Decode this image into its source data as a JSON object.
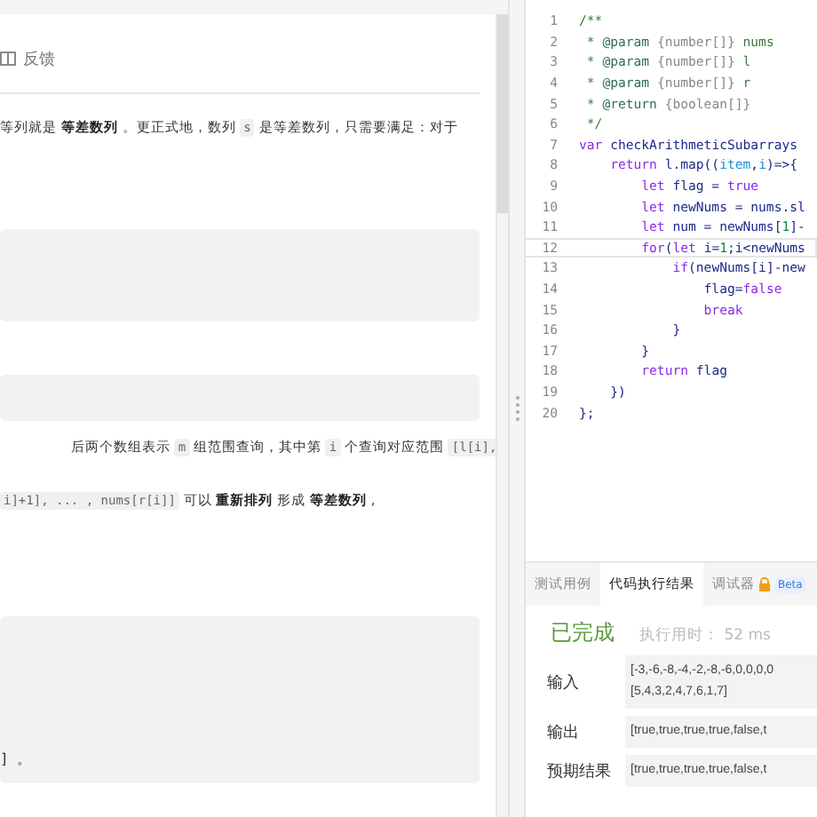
{
  "toolbar": {
    "feedback": "反馈"
  },
  "description": {
    "paras": [
      [
        {
          "text": "等列就是 ",
          "kind": "text"
        },
        {
          "text": "等差数列",
          "kind": "bold"
        },
        {
          "text": " 。更正式地，数列 ",
          "kind": "text"
        },
        {
          "text": "s",
          "kind": "code"
        },
        {
          "text": " 是等差数列，只需要满足：对于",
          "kind": "text"
        }
      ],
      [
        {
          "text": "后两个数组表示 ",
          "kind": "text"
        },
        {
          "text": "m",
          "kind": "code"
        },
        {
          "text": " 组范围查询，其中第 ",
          "kind": "text"
        },
        {
          "text": "i",
          "kind": "code"
        },
        {
          "text": " 个查询对应范围 ",
          "kind": "text"
        },
        {
          "text": "[l[i],",
          "kind": "code"
        }
      ],
      [
        {
          "text": "i]+1], ... , nums[r[i]]",
          "kind": "code"
        },
        {
          "text": " 可以 ",
          "kind": "text"
        },
        {
          "text": "重新排列",
          "kind": "bold"
        },
        {
          "text": " 形成 ",
          "kind": "text"
        },
        {
          "text": "等差数列",
          "kind": "bold"
        },
        {
          "text": " ,",
          "kind": "text"
        }
      ]
    ],
    "example_tail": "] 。"
  },
  "editor": {
    "lines": [
      {
        "no": "1",
        "selected": false,
        "tokens": [
          {
            "text": "/**",
            "kind": "comment"
          }
        ]
      },
      {
        "no": "2",
        "selected": false,
        "tokens": [
          {
            "text": " * ",
            "kind": "comment"
          },
          {
            "text": "@param",
            "kind": "tag"
          },
          {
            "text": " {number[]} ",
            "kind": "type"
          },
          {
            "text": "nums",
            "kind": "comment"
          }
        ]
      },
      {
        "no": "3",
        "selected": false,
        "tokens": [
          {
            "text": " * ",
            "kind": "comment"
          },
          {
            "text": "@param",
            "kind": "tag"
          },
          {
            "text": " {number[]} ",
            "kind": "type"
          },
          {
            "text": "l",
            "kind": "comment"
          }
        ]
      },
      {
        "no": "4",
        "selected": false,
        "tokens": [
          {
            "text": " * ",
            "kind": "comment"
          },
          {
            "text": "@param",
            "kind": "tag"
          },
          {
            "text": " {number[]} ",
            "kind": "type"
          },
          {
            "text": "r",
            "kind": "comment"
          }
        ]
      },
      {
        "no": "5",
        "selected": false,
        "tokens": [
          {
            "text": " * ",
            "kind": "comment"
          },
          {
            "text": "@return",
            "kind": "tag"
          },
          {
            "text": " {boolean[]}",
            "kind": "type"
          }
        ]
      },
      {
        "no": "6",
        "selected": false,
        "tokens": [
          {
            "text": " */",
            "kind": "comment"
          }
        ]
      },
      {
        "no": "7",
        "selected": false,
        "tokens": [
          {
            "text": "var ",
            "kind": "keyword"
          },
          {
            "text": "checkArithmeticSubarrays",
            "kind": "plain"
          }
        ]
      },
      {
        "no": "8",
        "selected": false,
        "tokens": [
          {
            "text": "    return ",
            "kind": "keyword"
          },
          {
            "text": "l.map((",
            "kind": "plain"
          },
          {
            "text": "item",
            "kind": "param"
          },
          {
            "text": ",",
            "kind": "plain"
          },
          {
            "text": "i",
            "kind": "param"
          },
          {
            "text": ")=>{",
            "kind": "plain"
          }
        ]
      },
      {
        "no": "9",
        "selected": false,
        "tokens": [
          {
            "text": "        let ",
            "kind": "keyword"
          },
          {
            "text": "flag = ",
            "kind": "plain"
          },
          {
            "text": "true",
            "kind": "keyword"
          }
        ]
      },
      {
        "no": "10",
        "selected": false,
        "tokens": [
          {
            "text": "        let ",
            "kind": "keyword"
          },
          {
            "text": "newNums = nums.sl",
            "kind": "plain"
          }
        ]
      },
      {
        "no": "11",
        "selected": false,
        "tokens": [
          {
            "text": "        let ",
            "kind": "keyword"
          },
          {
            "text": "num = newNums[",
            "kind": "plain"
          },
          {
            "text": "1",
            "kind": "number"
          },
          {
            "text": "]-",
            "kind": "plain"
          }
        ]
      },
      {
        "no": "12",
        "selected": true,
        "tokens": [
          {
            "text": "        for",
            "kind": "keyword"
          },
          {
            "text": "(",
            "kind": "plain"
          },
          {
            "text": "let ",
            "kind": "keyword"
          },
          {
            "text": "i=",
            "kind": "plain"
          },
          {
            "text": "1",
            "kind": "number"
          },
          {
            "text": ";i<newNums",
            "kind": "plain"
          }
        ]
      },
      {
        "no": "13",
        "selected": false,
        "tokens": [
          {
            "text": "            if",
            "kind": "keyword"
          },
          {
            "text": "(newNums[i]-new",
            "kind": "plain"
          }
        ]
      },
      {
        "no": "14",
        "selected": false,
        "tokens": [
          {
            "text": "                flag=",
            "kind": "plain"
          },
          {
            "text": "false",
            "kind": "keyword"
          }
        ]
      },
      {
        "no": "15",
        "selected": false,
        "tokens": [
          {
            "text": "                break",
            "kind": "keyword"
          }
        ]
      },
      {
        "no": "16",
        "selected": false,
        "tokens": [
          {
            "text": "            }",
            "kind": "plain"
          }
        ]
      },
      {
        "no": "17",
        "selected": false,
        "tokens": [
          {
            "text": "        }",
            "kind": "plain"
          }
        ]
      },
      {
        "no": "18",
        "selected": false,
        "tokens": [
          {
            "text": "        return ",
            "kind": "keyword"
          },
          {
            "text": "flag",
            "kind": "plain"
          }
        ]
      },
      {
        "no": "19",
        "selected": false,
        "tokens": [
          {
            "text": "    })",
            "kind": "plain"
          }
        ]
      },
      {
        "no": "20",
        "selected": false,
        "tokens": [
          {
            "text": "};",
            "kind": "plain"
          }
        ]
      }
    ]
  },
  "console": {
    "tabs": [
      {
        "label": "测试用例",
        "selected": false
      },
      {
        "label": "代码执行结果",
        "selected": true
      },
      {
        "label": "调试器",
        "selected": false,
        "badge": "Beta"
      }
    ],
    "status": "已完成",
    "runtime": "执行用时： 52 ms",
    "rows": [
      {
        "label": "输入",
        "lines": [
          "[-3,-6,-8,-4,-2,-8,-6,0,0,0,0",
          "[5,4,3,2,4,7,6,1,7]"
        ]
      },
      {
        "label": "输出",
        "lines": [
          "[true,true,true,true,false,t"
        ]
      },
      {
        "label": "预期结果",
        "lines": [
          "[true,true,true,true,false,t"
        ]
      }
    ]
  }
}
